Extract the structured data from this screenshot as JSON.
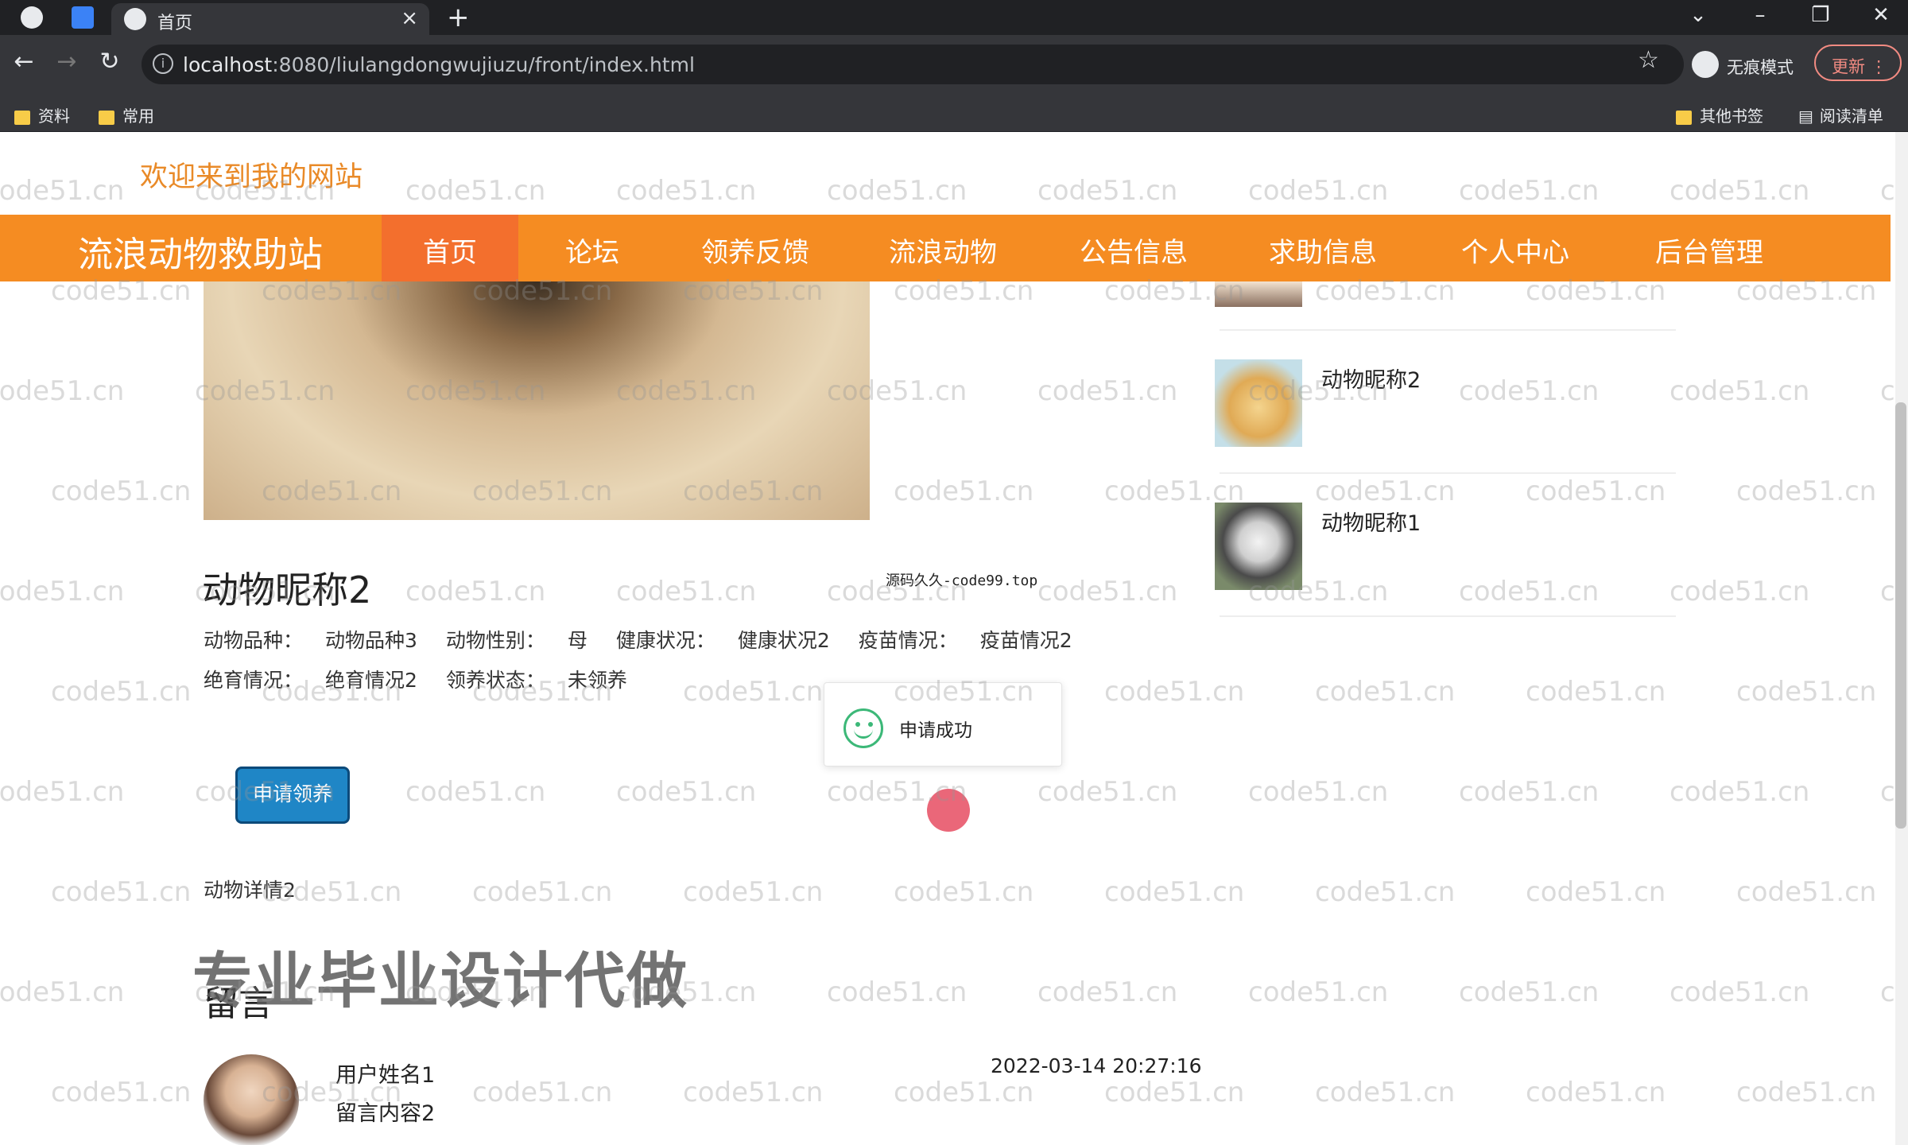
{
  "browser": {
    "tab_title": "首页",
    "url_host": "localhost",
    "url_rest": ":8080/liulangdongwujiuzu/front/index.html",
    "incognito_label": "无痕模式",
    "update_label": "更新",
    "bookmarks": [
      "资料",
      "常用"
    ],
    "other_bookmarks": "其他书签",
    "reading_list": "阅读清单"
  },
  "site": {
    "welcome": "欢迎来到我的网站",
    "brand": "流浪动物救助站",
    "nav": [
      "首页",
      "论坛",
      "领养反馈",
      "流浪动物",
      "公告信息",
      "求助信息",
      "个人中心",
      "后台管理"
    ],
    "active_nav": "首页"
  },
  "animal": {
    "name": "动物昵称2",
    "breed_label": "动物品种：",
    "breed": "动物品种3",
    "gender_label": "动物性别：",
    "gender": "母",
    "health_label": "健康状况：",
    "health": "健康状况2",
    "vaccine_label": "疫苗情况：",
    "vaccine": "疫苗情况2",
    "sterile_label": "绝育情况：",
    "sterile": "绝育情况2",
    "adopt_label": "领养状态：",
    "adopt": "未领养",
    "apply_button": "申请领养",
    "detail": "动物详情2"
  },
  "comments": {
    "title": "留言",
    "items": [
      {
        "user": "用户姓名1",
        "content": "留言内容2",
        "time": "2022-03-14 20:27:16"
      }
    ]
  },
  "sidebar": {
    "items": [
      {
        "label": "动物昵称2",
        "icon": "puppy-photo"
      },
      {
        "label": "动物昵称1",
        "icon": "cat-photo"
      }
    ]
  },
  "toast": {
    "text": "申请成功"
  },
  "overlay_text": "专业毕业设计代做",
  "source_watermark": "源码久久-code99.top",
  "watermark": "code51.cn"
}
